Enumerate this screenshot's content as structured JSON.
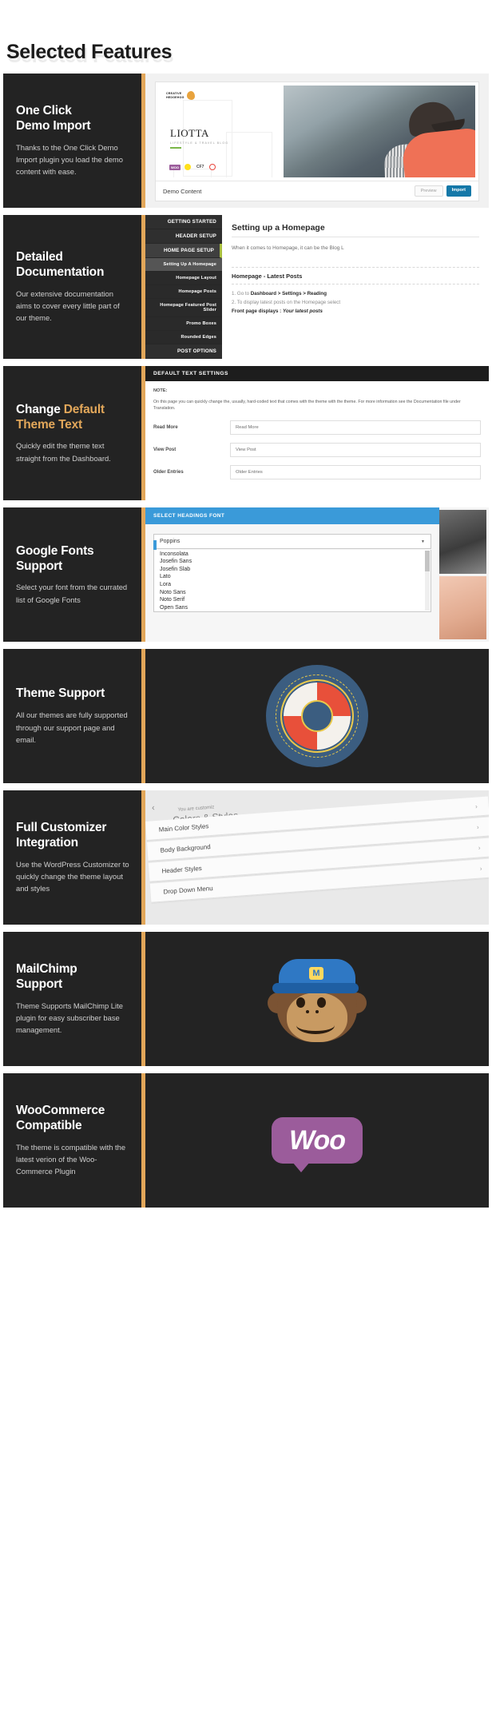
{
  "page": {
    "title": "Selected Features"
  },
  "features": [
    {
      "title_line1": "One Click",
      "title_line2": "Demo Import",
      "description": "Thanks to the One Click Demo Import plugin you load the demo content with ease.",
      "preview": {
        "type": "demo-import",
        "logo_line1": "CREATIVE",
        "logo_line2": "HEDGEHOG",
        "brand": "LIOTTA",
        "brand_tagline": "LIFESTYLE & TRAVEL BLOG",
        "plugins": [
          "woo",
          "mailchimp",
          "CF7",
          "contact-form"
        ],
        "bar_label": "Demo Content",
        "preview_button": "Preview",
        "import_button": "Import"
      }
    },
    {
      "title_line1": "Detailed",
      "title_line2": "Documentation",
      "description": "Our extensive documentation aims to cover every little part of our theme.",
      "preview": {
        "type": "documentation",
        "nav": [
          {
            "label": "GETTING STARTED",
            "state": "normal",
            "level": "top"
          },
          {
            "label": "HEADER SETUP",
            "state": "normal",
            "level": "top"
          },
          {
            "label": "HOME PAGE SETUP",
            "state": "active",
            "level": "top"
          },
          {
            "label": "Setting Up A Homepage",
            "state": "selected",
            "level": "sub"
          },
          {
            "label": "Homepage Layout",
            "state": "normal",
            "level": "sub"
          },
          {
            "label": "Homepage Posts",
            "state": "normal",
            "level": "sub"
          },
          {
            "label": "Homepage Featured Post Slider",
            "state": "normal",
            "level": "sub"
          },
          {
            "label": "Promo Boxes",
            "state": "normal",
            "level": "sub"
          },
          {
            "label": "Rounded Edges",
            "state": "normal",
            "level": "sub"
          },
          {
            "label": "POST OPTIONS",
            "state": "normal",
            "level": "top"
          }
        ],
        "heading": "Setting up a Homepage",
        "paragraph": "When it comes to Homepage, it can be the Blog L",
        "subheading": "Homepage - Latest Posts",
        "step1_prefix": "1. Go to ",
        "step1_bold": "Dashboard > Settings > Reading",
        "step2": "2. To display latest posts on the Homepage select",
        "step3_label": "Front page displays : ",
        "step3_value": "Your latest posts"
      }
    },
    {
      "title_line1": "Change ",
      "title_accent": "Default",
      "title_line2": "Theme Text",
      "description": "Quickly edit the theme text straight from the Dashboard.",
      "preview": {
        "type": "default-text-settings",
        "header": "DEFAULT TEXT SETTINGS",
        "note_label": "NOTE:",
        "note_body": "On this page you can quickly change the, usually, hard-coded text that comes with the theme with the theme. For more information see the Documentation file under Translation.",
        "rows": [
          {
            "label": "Read More",
            "value": "Read More"
          },
          {
            "label": "View Post",
            "value": "View Post"
          },
          {
            "label": "Older Entries",
            "value": "Older Entries"
          }
        ]
      }
    },
    {
      "title_line1": "Google Fonts",
      "title_line2": "Support",
      "description": "Select your font from the currated list of Google Fonts",
      "preview": {
        "type": "google-fonts",
        "header": "SELECT HEADINGS FONT",
        "selected": "Poppins",
        "caret": "chevron-down-icon",
        "options": [
          "Inconsolata",
          "Josefin Sans",
          "Josefin Slab",
          "Lato",
          "Lora",
          "Noto Sans",
          "Noto Serif",
          "Open Sans"
        ]
      }
    },
    {
      "title_line1": "Theme Support",
      "title_line2": "",
      "description": "All our themes are fully supported through our support page and email.",
      "preview": {
        "type": "lifebuoy",
        "icon": "lifebuoy-icon"
      }
    },
    {
      "title_line1": "Full Customizer",
      "title_line2": "Integration",
      "description": "Use the WordPress Customizer to quickly change the theme layout and styles",
      "preview": {
        "type": "customizer",
        "top_label": "You are customiz",
        "panel_title": "Colors & Styles",
        "back_icon": "chevron-left-icon",
        "rows": [
          "Main Color Styles",
          "Body Background",
          "Header Styles",
          "Drop Down Menu"
        ],
        "row_chevron": "chevron-right-icon"
      }
    },
    {
      "title_line1": "MailChimp",
      "title_line2": "Support",
      "description": "Theme Supports MailChimp Lite plugin for easy subscriber base management.",
      "preview": {
        "type": "mailchimp",
        "icon": "freddie-monkey-icon",
        "badge": "M"
      }
    },
    {
      "title_line1": "WooCommerce",
      "title_line2": "Compatible",
      "description": "The theme is compatible with the latest verion of the Woo-Commerce Plugin",
      "preview": {
        "type": "woocommerce",
        "logo_text": "Woo"
      }
    }
  ],
  "colors": {
    "card_background": "#232323",
    "accent_bar": "#e2a75a",
    "accent_text": "#e2a75a",
    "title": "#1b1b1b",
    "description": "#cfcfcf",
    "import_button": "#1578a8",
    "fonts_header": "#3a9ad9",
    "buoy_background": "#3b5d80",
    "buoy_red": "#e8503a",
    "woo_purple": "#9b5c9b"
  }
}
